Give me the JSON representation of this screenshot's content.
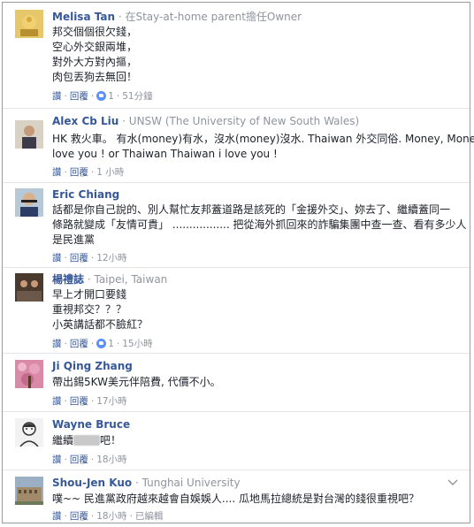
{
  "comments": [
    {
      "name": "Melisa Tan",
      "meta": "· 在Stay-at-home parent擔任Owner",
      "lines": [
        "邦交個個很欠錢，",
        "空心外交銀兩堆，",
        "對外大方對內摳，",
        "肉包丟狗去無回！"
      ],
      "reply": "讚",
      "reply2": "回覆",
      "likes": "1",
      "time": "51分鐘"
    },
    {
      "name": "Alex Cb Liu",
      "meta": "· UNSW (The University of New South Wales)",
      "lines": [
        "HK 救火車。 有水(money)有水，沒水(money)沒水. Thaiwan 外交同俗. Money, Money i",
        "love you ! or Thaiwan Thaiwan i love you !"
      ],
      "reply": "讚",
      "reply2": "回覆",
      "time": "1 小時"
    },
    {
      "name": "Eric Chiang",
      "meta": "",
      "lines": [
        "話都是你自己說的、別人幫忙友邦蓋道路是該死的「金援外交」、妳去了、繼續蓋同一",
        "條路就變成「友情可貴」 ................. 把從海外抓回來的詐騙集團中查一查、看有多少人",
        "是民進黨"
      ],
      "reply": "讚",
      "reply2": "回覆",
      "time": "12小時"
    },
    {
      "name": "楊禮誌",
      "meta": "· Taipei, Taiwan",
      "lines": [
        "早上才開口要錢",
        "重視邦交？？？",
        "小英講話都不臉紅？"
      ],
      "reply": "讚",
      "reply2": "回覆",
      "likes": "1",
      "time": "15小時"
    },
    {
      "name": "Ji Qing Zhang",
      "meta": "",
      "lines": [
        "帶出錫5KW美元伴陪費, 代價不小。"
      ],
      "reply": "讚",
      "reply2": "回覆",
      "time": "17小時"
    },
    {
      "name": "Wayne Bruce",
      "meta": "",
      "line_prefix": "繼續",
      "line_suffix": "吧！",
      "reply": "讚",
      "reply2": "回覆",
      "time": "18小時"
    },
    {
      "name": "Shou-Jen Kuo",
      "meta": "· Tunghai University",
      "lines": [
        "噗~~ 民進黨政府越來越會自娛娛人.... 瓜地馬拉總統是對台灣的錢很重視吧？"
      ],
      "reply": "讚",
      "reply2": "回覆",
      "time": "18小時",
      "edited": "已編輯"
    }
  ],
  "colors": {
    "name": "#365899",
    "meta": "#90949c",
    "text": "#1d2129",
    "like": "#5890ff"
  }
}
